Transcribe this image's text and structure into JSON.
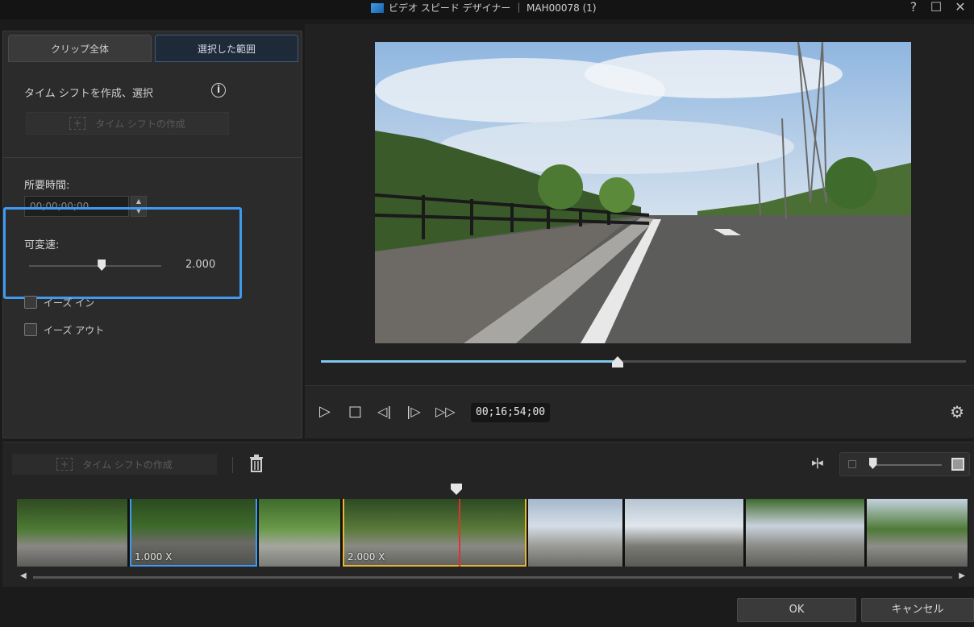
{
  "window": {
    "title": "ビデオ スピード デザイナー ｜ MAH00078 (1)",
    "help": "?",
    "maximize": "☐",
    "close": "✕"
  },
  "tabs": [
    "クリップ全体",
    "選択した範囲"
  ],
  "timeshift": {
    "header": "タイム シフトを作成、選択",
    "info": "i",
    "create_label": "タイム シフトの作成",
    "plus": "+"
  },
  "duration": {
    "label": "所要時間:",
    "value": "00;00;00;00"
  },
  "speed": {
    "label": "可変速:",
    "value": "2.000",
    "slider_fraction": 0.55
  },
  "ease": {
    "in_label": "イーズ イン",
    "out_label": "イーズ アウト"
  },
  "playback": {
    "timecode": "00;16;54;00",
    "progress_fraction": 0.46
  },
  "timeline": {
    "create_label": "タイム シフトの作成",
    "clip1_speed": "1.000 X",
    "clip2_speed": "2.000 X",
    "zoom_fraction": 0.05
  },
  "buttons": {
    "ok": "OK",
    "cancel": "キャンセル"
  },
  "colors": {
    "accent_blue": "#3d9bf0",
    "accent_yellow": "#e8b630",
    "playhead_red": "#e03030",
    "progress": "#7ec8e8"
  }
}
